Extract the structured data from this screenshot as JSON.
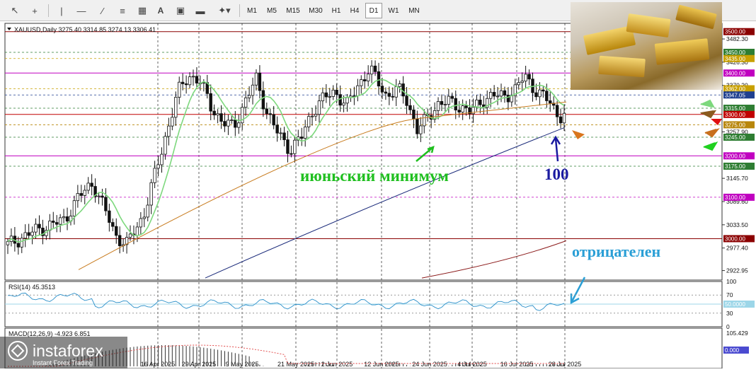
{
  "toolbar": {
    "icons": [
      "cursor-icon",
      "crosshair-icon",
      "vertical-line-icon",
      "horizontal-line-icon",
      "trendline-icon",
      "fibonacci-icon",
      "channel-icon",
      "text-icon",
      "text-label-icon",
      "rectangle-icon",
      "shapes-icon"
    ],
    "text_tool": "A",
    "timeframes": [
      "M1",
      "M5",
      "M15",
      "M30",
      "H1",
      "H4",
      "D1",
      "W1",
      "MN"
    ],
    "active_timeframe": "D1"
  },
  "chart_data": {
    "type": "candlestick",
    "symbol": "XAUUSD,Daily",
    "ohlc_readout": "3275.40 3314.85 3274.13 3306.41",
    "ylim": [
      2900,
      3520
    ],
    "y_tick_labels": [
      "3482.30",
      "3426.30",
      "3370.20",
      "3257.90",
      "3145.70",
      "3089.60",
      "3033.50",
      "2977.40",
      "2922.95"
    ],
    "x_tick_labels": [
      "16 Apr 2025",
      "29 Apr 2025",
      "9 May 2025",
      "21 May 2025",
      "2 Jun 2025",
      "12 Jun 2025",
      "24 Jun 2025",
      "4 Jul 2025",
      "16 Jul 2025",
      "28 Jul 2025"
    ],
    "levels": [
      {
        "value": 3500,
        "label": "3500.00",
        "color": "#8b0000",
        "style": "solid"
      },
      {
        "value": 3450,
        "label": "3450.00",
        "color": "#2e7d32",
        "style": "dashed"
      },
      {
        "value": 3435,
        "label": "3435.00",
        "color": "#c8a000",
        "style": "dashed"
      },
      {
        "value": 3400,
        "label": "3400.00",
        "color": "#c000c0",
        "style": "solid"
      },
      {
        "value": 3362,
        "label": "3362.00",
        "color": "#c8a000",
        "style": "dashed"
      },
      {
        "value": 3347.05,
        "label": "3347.05",
        "color": "#1f3f8f",
        "style": "dashed"
      },
      {
        "value": 3315,
        "label": "3315.00",
        "color": "#2e7d32",
        "style": "dashed"
      },
      {
        "value": 3300,
        "label": "3300.00",
        "color": "#c00000",
        "style": "solid"
      },
      {
        "value": 3275,
        "label": "3275.00",
        "color": "#b8860b",
        "style": "dashed"
      },
      {
        "value": 3245,
        "label": "3245.00",
        "color": "#2e7d32",
        "style": "dashed"
      },
      {
        "value": 3200,
        "label": "3200.00",
        "color": "#c000c0",
        "style": "solid"
      },
      {
        "value": 3175,
        "label": "3175.00",
        "color": "#2e7d32",
        "style": "dashed"
      },
      {
        "value": 3100,
        "label": "3100.00",
        "color": "#c000c0",
        "style": "dashed"
      },
      {
        "value": 3000,
        "label": "3000.00",
        "color": "#8b0000",
        "style": "solid"
      }
    ],
    "rsi": {
      "label": "RSI(14) 45.3513",
      "ticks": [
        "100",
        "70",
        "30",
        "0"
      ],
      "marker_label": "50.0000"
    },
    "macd": {
      "label": "MACD(12,26,9) -4.923 6.851",
      "ticks": [
        "105.429"
      ],
      "marker_label": "0.000"
    },
    "annotations": [
      {
        "text": "июньский минимум",
        "color": "#1fbf1f"
      },
      {
        "text": "100",
        "color": "#1a1aa0"
      },
      {
        "text": "отрицателен",
        "color": "#2a9fd6"
      }
    ]
  },
  "watermark": {
    "brand": "instaforex",
    "tagline": "Instant Forex Trading"
  }
}
